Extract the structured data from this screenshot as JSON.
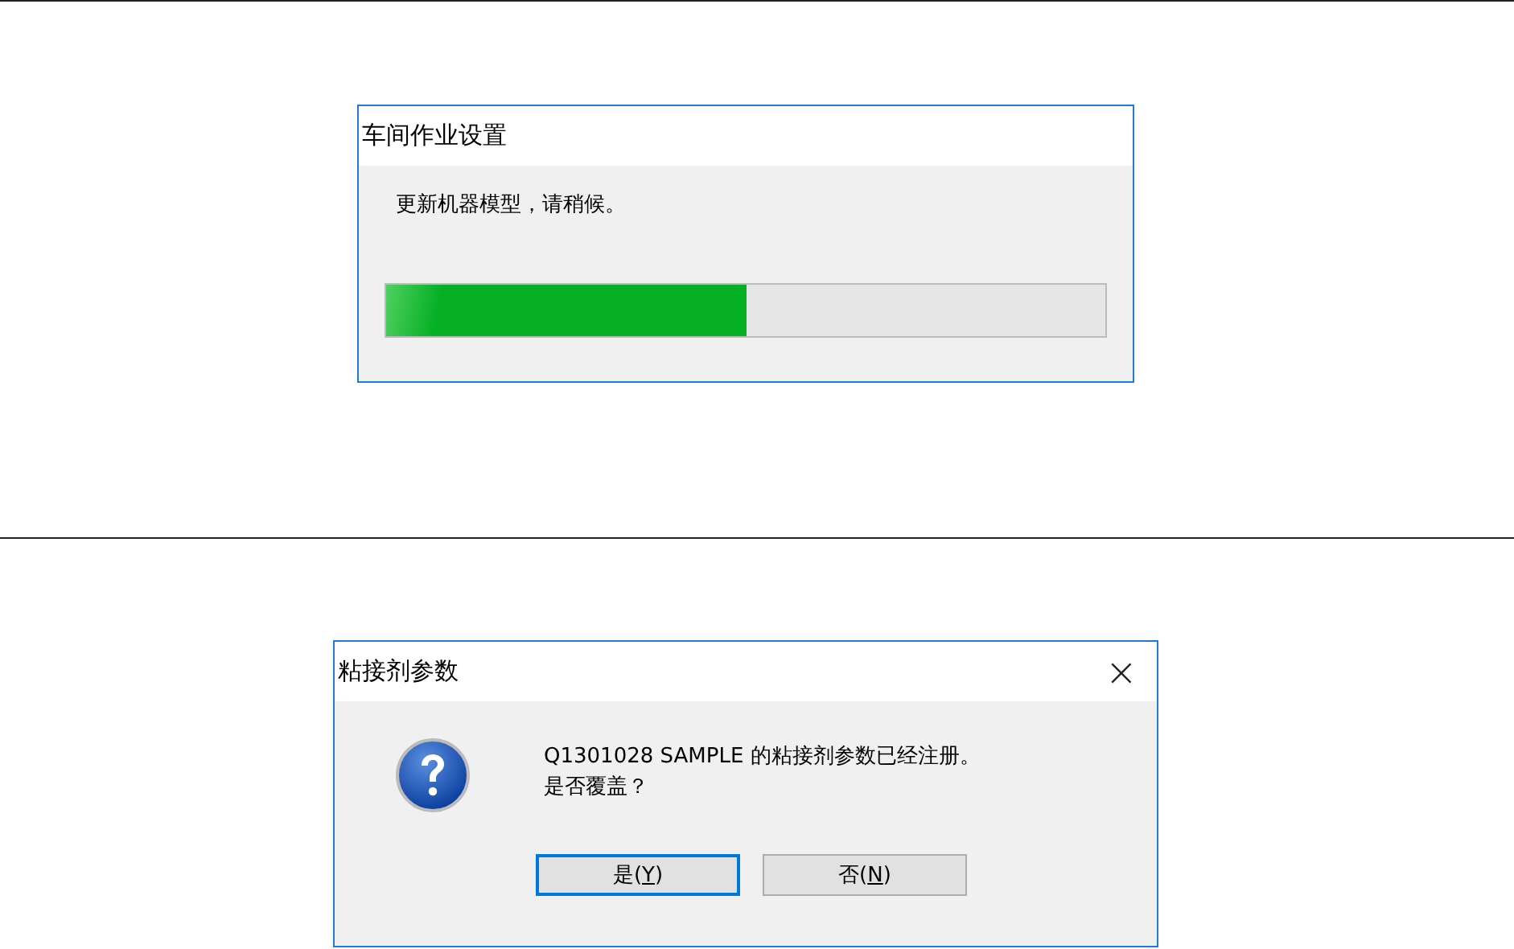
{
  "progress_dialog": {
    "title": "车间作业设置",
    "message": "更新机器模型，请稍候。",
    "progress": {
      "level": 0.5
    }
  },
  "confirm_dialog": {
    "title": "粘接剂参数",
    "close": "×",
    "message_lines": [
      "Q1301028 SAMPLE 的粘接剂参数已经注册。",
      "是否覆盖？"
    ],
    "buttons": [
      {
        "before": "是(",
        "access_key": "Y",
        "after": ")",
        "default": true
      },
      {
        "before": "否(",
        "access_key": "N",
        "after": ")",
        "default": false
      }
    ]
  }
}
